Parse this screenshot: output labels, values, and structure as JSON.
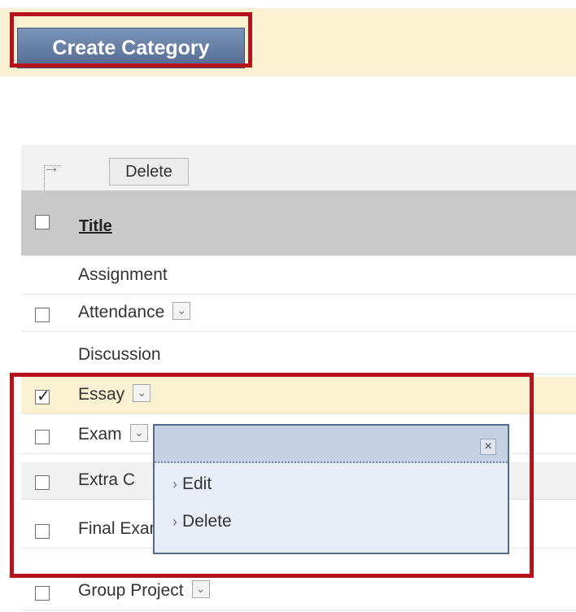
{
  "action_bar": {
    "create_category_label": "Create Category"
  },
  "list_toolbar": {
    "delete_label": "Delete",
    "arrow_icon": "corner-arrow-icon"
  },
  "table": {
    "header_title": "Title",
    "rows": [
      {
        "label": "Assignment",
        "checkbox": false,
        "checked": false,
        "menu": false
      },
      {
        "label": "Attendance",
        "checkbox": true,
        "checked": false,
        "menu": true
      },
      {
        "label": "Discussion",
        "checkbox": false,
        "checked": false,
        "menu": false
      },
      {
        "label": "Essay",
        "checkbox": true,
        "checked": true,
        "menu": true
      },
      {
        "label": "Exam",
        "checkbox": true,
        "checked": false,
        "menu": true
      },
      {
        "label": "Extra C",
        "checkbox": true,
        "checked": false,
        "menu": false
      },
      {
        "label": "Final Exam",
        "checkbox": true,
        "checked": false,
        "menu": true
      },
      {
        "label": "Group Project",
        "checkbox": true,
        "checked": false,
        "menu": true
      }
    ]
  },
  "popup": {
    "close_glyph": "×",
    "items": [
      {
        "label": "Edit"
      },
      {
        "label": "Delete"
      }
    ]
  },
  "colors": {
    "highlight_outline": "#b5121b",
    "button_blue": "#5f759b",
    "row_highlight": "#faf0d2"
  }
}
